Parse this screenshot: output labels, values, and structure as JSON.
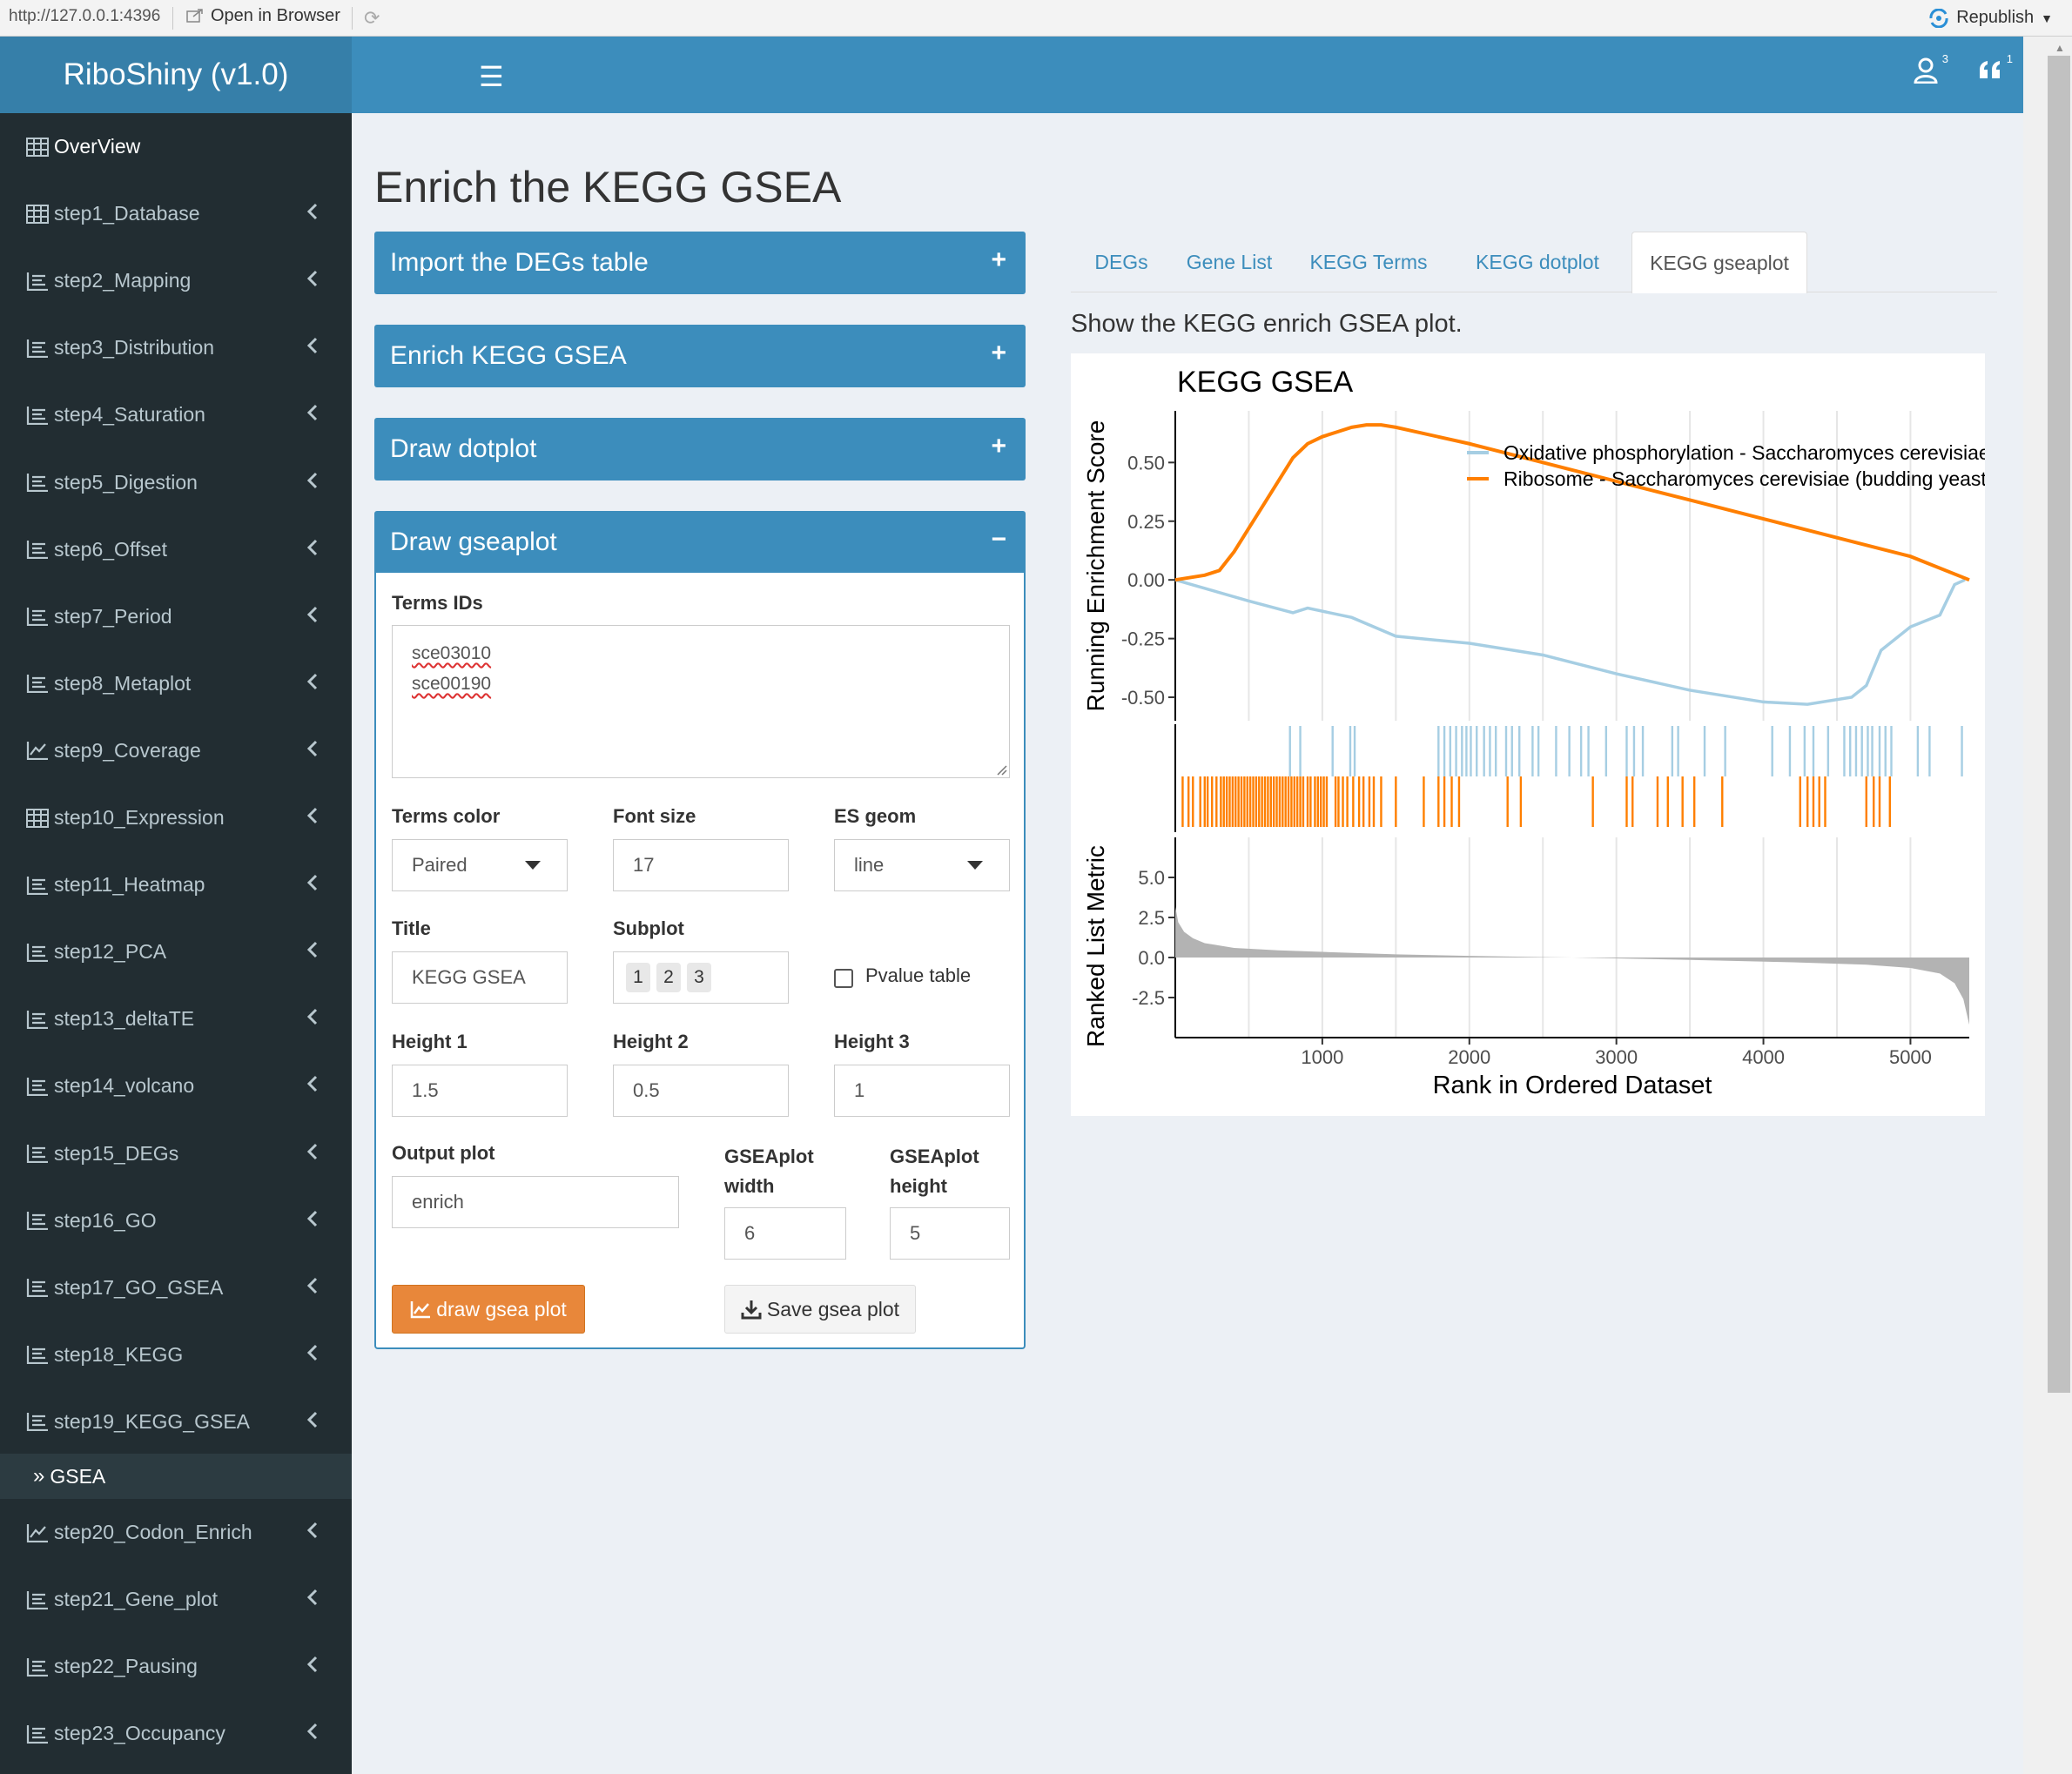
{
  "browser": {
    "url": "http://127.0.0.1:4396",
    "open_in_browser": "Open in Browser",
    "republish": "Republish"
  },
  "header": {
    "app_title": "RiboShiny (v1.0)",
    "user_badge": "3",
    "quote_badge": "1"
  },
  "sidebar": {
    "items": [
      {
        "label": "OverView",
        "icon": "table-icon",
        "chevron": false
      },
      {
        "label": "step1_Database",
        "icon": "table-icon",
        "chevron": true
      },
      {
        "label": "step2_Mapping",
        "icon": "list-icon",
        "chevron": true
      },
      {
        "label": "step3_Distribution",
        "icon": "list-icon",
        "chevron": true
      },
      {
        "label": "step4_Saturation",
        "icon": "list-icon",
        "chevron": true
      },
      {
        "label": "step5_Digestion",
        "icon": "list-icon",
        "chevron": true
      },
      {
        "label": "step6_Offset",
        "icon": "list-icon",
        "chevron": true
      },
      {
        "label": "step7_Period",
        "icon": "list-icon",
        "chevron": true
      },
      {
        "label": "step8_Metaplot",
        "icon": "list-icon",
        "chevron": true
      },
      {
        "label": "step9_Coverage",
        "icon": "chart-line-icon",
        "chevron": true
      },
      {
        "label": "step10_Expression",
        "icon": "table-icon",
        "chevron": true
      },
      {
        "label": "step11_Heatmap",
        "icon": "list-icon",
        "chevron": true
      },
      {
        "label": "step12_PCA",
        "icon": "list-icon",
        "chevron": true
      },
      {
        "label": "step13_deltaTE",
        "icon": "list-icon",
        "chevron": true
      },
      {
        "label": "step14_volcano",
        "icon": "list-icon",
        "chevron": true
      },
      {
        "label": "step15_DEGs",
        "icon": "list-icon",
        "chevron": true
      },
      {
        "label": "step16_GO",
        "icon": "list-icon",
        "chevron": true
      },
      {
        "label": "step17_GO_GSEA",
        "icon": "list-icon",
        "chevron": true
      },
      {
        "label": "step18_KEGG",
        "icon": "list-icon",
        "chevron": true
      },
      {
        "label": "step19_KEGG_GSEA",
        "icon": "list-icon",
        "chevron": true
      }
    ],
    "active_sub": "GSEA",
    "items_after": [
      {
        "label": "step20_Codon_Enrich",
        "icon": "chart-line-icon",
        "chevron": true
      },
      {
        "label": "step21_Gene_plot",
        "icon": "list-icon",
        "chevron": true
      },
      {
        "label": "step22_Pausing",
        "icon": "list-icon",
        "chevron": true
      },
      {
        "label": "step23_Occupancy",
        "icon": "list-icon",
        "chevron": true
      }
    ]
  },
  "main": {
    "title": "Enrich the KEGG GSEA",
    "boxes": {
      "import": "Import the DEGs table",
      "enrich": "Enrich KEGG GSEA",
      "dotplot": "Draw dotplot",
      "gseaplot": "Draw gseaplot"
    },
    "box_tools": {
      "collapsed": "+",
      "expanded": "−"
    },
    "form": {
      "terms_ids_label": "Terms IDs",
      "terms_ids": [
        "sce03010",
        "sce00190"
      ],
      "terms_color_label": "Terms color",
      "terms_color": "Paired",
      "font_size_label": "Font size",
      "font_size": "17",
      "es_geom_label": "ES geom",
      "es_geom": "line",
      "title_label": "Title",
      "title_value": "KEGG GSEA",
      "subplot_label": "Subplot",
      "subplot": [
        "1",
        "2",
        "3"
      ],
      "pvalue_table_label": "Pvalue table",
      "pvalue_table_checked": false,
      "height1_label": "Height 1",
      "height1": "1.5",
      "height2_label": "Height 2",
      "height2": "0.5",
      "height3_label": "Height 3",
      "height3": "1",
      "output_plot_label": "Output plot",
      "output_plot": "enrich",
      "width_label_1": "GSEAplot",
      "width_label_2": "width",
      "width": "6",
      "height_label_1": "GSEAplot",
      "height_label_2": "height",
      "height": "5",
      "draw_button": "draw gsea plot",
      "save_button": "Save gsea plot"
    },
    "tabs": [
      "DEGs",
      "Gene List",
      "KEGG Terms",
      "KEGG dotplot",
      "KEGG gseaplot"
    ],
    "active_tab": "KEGG gseaplot",
    "plot_description": "Show the KEGG enrich GSEA plot."
  },
  "chart_data": {
    "type": "line",
    "title": "KEGG GSEA",
    "xlabel": "Rank in Ordered Dataset",
    "xlim": [
      0,
      5400
    ],
    "x_ticks": [
      "1000",
      "2000",
      "3000",
      "4000",
      "5000"
    ],
    "panels": {
      "running_es": {
        "ylabel": "Running Enrichment Score",
        "ylim": [
          -0.6,
          0.72
        ],
        "y_ticks": [
          "0.50",
          "0.25",
          "0.00",
          "-0.25",
          "-0.50"
        ],
        "series": [
          {
            "name": "Oxidative phosphorylation - Saccharomyces cerevisiae (budding yeast)",
            "color": "#a6cee3",
            "x": [
              0,
              500,
              800,
              900,
              1200,
              1500,
              2000,
              2500,
              3000,
              3500,
              4000,
              4300,
              4600,
              4700,
              4800,
              5000,
              5200,
              5300,
              5370
            ],
            "y": [
              0.0,
              -0.09,
              -0.14,
              -0.12,
              -0.16,
              -0.24,
              -0.27,
              -0.32,
              -0.4,
              -0.47,
              -0.52,
              -0.53,
              -0.5,
              -0.45,
              -0.3,
              -0.2,
              -0.15,
              -0.02,
              0.0
            ]
          },
          {
            "name": "Ribosome - Saccharomyces cerevisiae (budding yeast)",
            "color": "#ff7f00",
            "x": [
              0,
              200,
              300,
              400,
              500,
              600,
              700,
              800,
              900,
              1000,
              1100,
              1200,
              1300,
              1400,
              1500,
              2000,
              2500,
              3000,
              3500,
              4000,
              4500,
              5000,
              5400
            ],
            "y": [
              0.0,
              0.02,
              0.04,
              0.12,
              0.22,
              0.32,
              0.42,
              0.52,
              0.58,
              0.61,
              0.63,
              0.65,
              0.66,
              0.66,
              0.65,
              0.58,
              0.5,
              0.42,
              0.34,
              0.26,
              0.18,
              0.1,
              0.0
            ]
          }
        ],
        "legend": "top-right"
      },
      "gene_hits": {
        "series": [
          {
            "name": "Oxidative phosphorylation",
            "color": "#a6cee3",
            "positions": [
              780,
              850,
              1070,
              1190,
              1220,
              1790,
              1830,
              1870,
              1910,
              1950,
              1980,
              2010,
              2050,
              2100,
              2140,
              2180,
              2250,
              2290,
              2340,
              2430,
              2470,
              2590,
              2680,
              2760,
              2810,
              2930,
              3070,
              3120,
              3180,
              3380,
              3420,
              3600,
              3740,
              4060,
              4180,
              4280,
              4340,
              4440,
              4550,
              4590,
              4630,
              4670,
              4710,
              4740,
              4790,
              4830,
              4870,
              5050,
              5130,
              5350
            ]
          },
          {
            "name": "Ribosome",
            "color": "#ff7f00",
            "positions": [
              50,
              90,
              120,
              170,
              200,
              220,
              250,
              280,
              310,
              330,
              350,
              370,
              390,
              410,
              430,
              450,
              470,
              490,
              510,
              530,
              550,
              570,
              590,
              610,
              630,
              650,
              670,
              690,
              710,
              730,
              750,
              770,
              790,
              810,
              830,
              850,
              870,
              900,
              920,
              950,
              970,
              990,
              1010,
              1030,
              1090,
              1110,
              1140,
              1170,
              1210,
              1250,
              1280,
              1320,
              1350,
              1400,
              1500,
              1690,
              1790,
              1830,
              1880,
              1930,
              2260,
              2350,
              2840,
              3070,
              3110,
              3280,
              3350,
              3450,
              3530,
              3720,
              4250,
              4300,
              4340,
              4380,
              4420,
              4700,
              4750,
              4790,
              4860
            ]
          }
        ]
      },
      "ranked_metric": {
        "ylabel": "Ranked List Metric",
        "ylim": [
          -5,
          7.5
        ],
        "y_ticks": [
          "5.0",
          "2.5",
          "0.0",
          "-2.5"
        ],
        "color": "#b3b3b3",
        "x": [
          0,
          20,
          60,
          120,
          200,
          400,
          700,
          1000,
          1500,
          2000,
          2700,
          3500,
          4200,
          4700,
          5000,
          5200,
          5300,
          5360,
          5400
        ],
        "y": [
          3.2,
          2.2,
          1.6,
          1.2,
          0.9,
          0.6,
          0.45,
          0.35,
          0.2,
          0.1,
          0.0,
          -0.15,
          -0.3,
          -0.45,
          -0.65,
          -1.0,
          -1.6,
          -2.6,
          -4.2
        ]
      }
    }
  },
  "colors": {
    "primary": "#3c8dbc",
    "logo": "#367fa9",
    "sidebar_bg": "#222d32",
    "sidebar_text": "#b8c7ce",
    "orange_button": "#e8873a"
  }
}
